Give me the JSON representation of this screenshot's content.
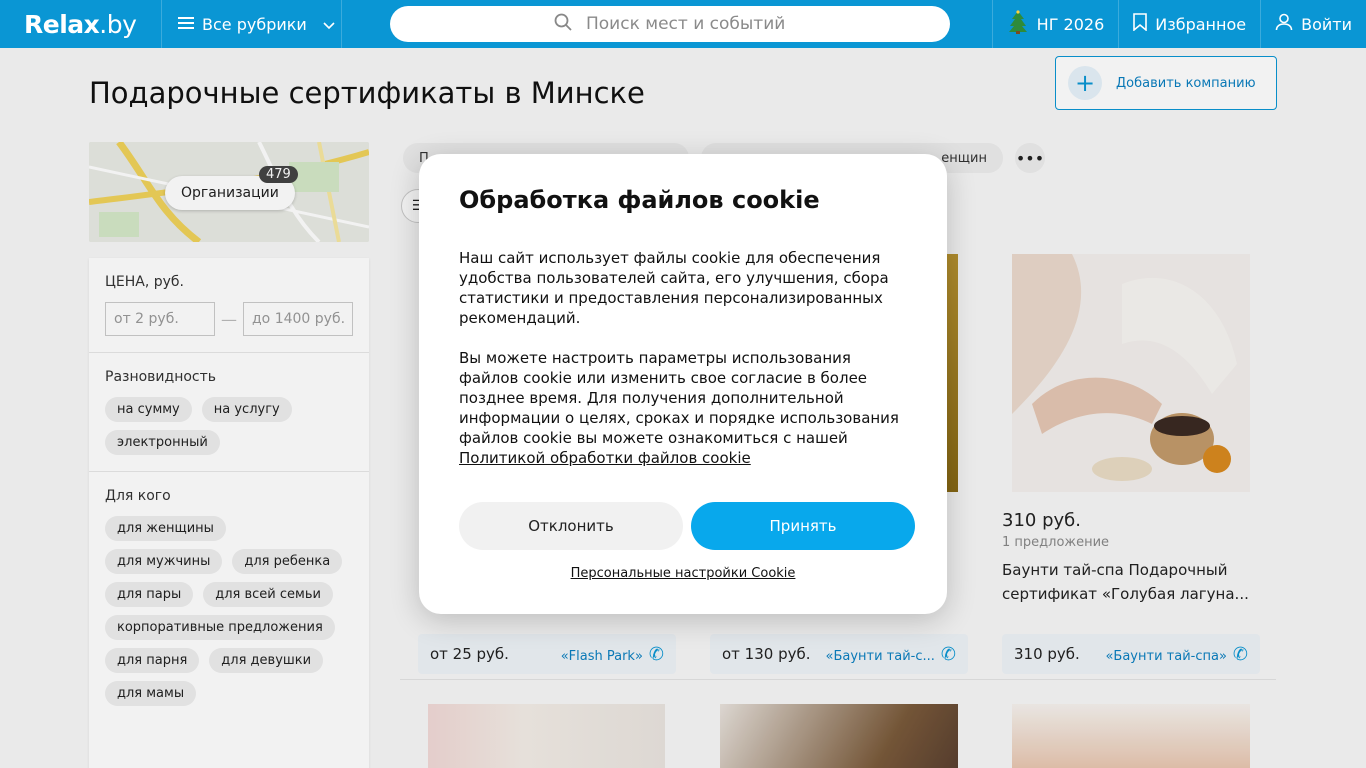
{
  "header": {
    "logo_main": "Relax",
    "logo_suffix": ".by",
    "rubrics_label": "Все рубрики",
    "search_placeholder": "Поиск мест и событий",
    "ny_label": "НГ 2026",
    "favorites_label": "Избранное",
    "login_label": "Войти"
  },
  "page": {
    "title": "Подарочные сертификаты в Минске",
    "add_company": "Добавить компанию",
    "map_label": "Организации",
    "map_count": "479"
  },
  "filters": {
    "price_title": "ЦЕНА, руб.",
    "price_from": "от 2 руб.",
    "price_to": "до 1400 руб.",
    "kind_title": "Разновидность",
    "kind_chips": [
      "на сумму",
      "на услугу",
      "электронный"
    ],
    "for_whom_title": "Для кого",
    "for_whom_chips": [
      "для женщины",
      "для мужчины",
      "для ребенка",
      "для пары",
      "для всей семьи",
      "корпоративные предложения",
      "для парня",
      "для девушки",
      "для мамы"
    ]
  },
  "tags": [
    "П",
    "Пр",
    "енщин"
  ],
  "cards": [
    {
      "price": "",
      "offers": "",
      "name": "",
      "bar_price": "от 25 руб.",
      "company": "«Flash Park»"
    },
    {
      "price": "",
      "offers": "",
      "name": "",
      "bar_price": "от 130 руб.",
      "company": "«Баунти тай-с..."
    },
    {
      "price": "310 руб.",
      "offers": "1 предложение",
      "name": "Баунти тай-спа Подарочный сертификат «Голубая лагуна...",
      "bar_price": "310 руб.",
      "company": "«Баунти тай-спа»"
    }
  ],
  "cookie": {
    "title": "Обработка файлов cookie",
    "p1": "Наш сайт использует файлы cookie для обеспечения удобства пользователей сайта, его улучшения, сбора статистики и предоставления персонализированных рекомендаций.",
    "p2": "Вы можете настроить параметры использования файлов cookie или изменить свое согласие в более позднее время. Для получения дополнительной информации о целях, сроках и порядке использования файлов cookie вы можете ознакомиться с нашей",
    "policy_link": "Политикой обработки файлов cookie",
    "decline": "Отклонить",
    "accept": "Принять",
    "personal": "Персональные настройки Cookie"
  },
  "colors": {
    "brand": "#0a96d4",
    "accept": "#08a8ec"
  }
}
